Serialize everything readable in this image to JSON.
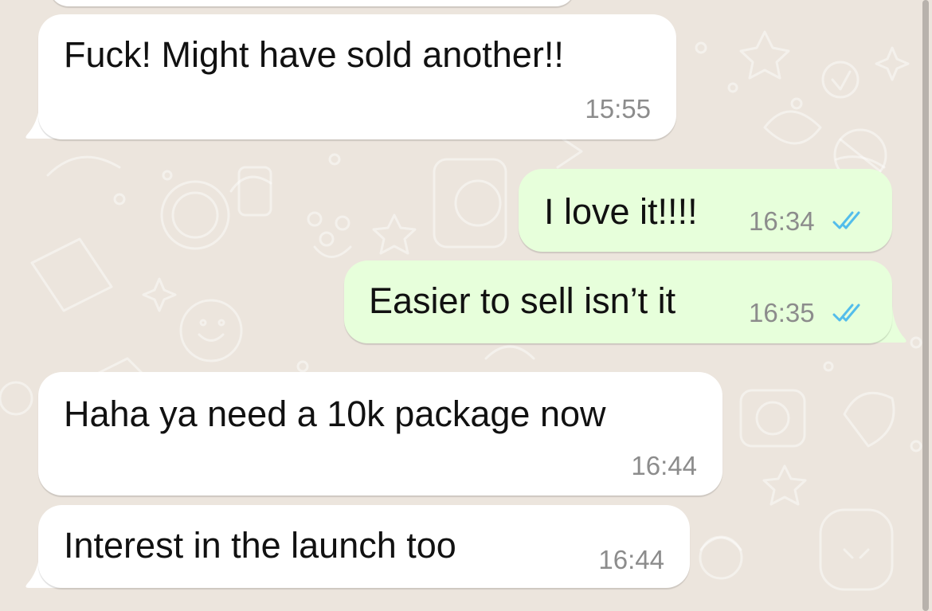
{
  "chat": {
    "background_color": "#ECE5DD",
    "incoming_bubble_color": "#FFFFFF",
    "outgoing_bubble_color": "#E7FFDB",
    "read_tick_color": "#53BDEB",
    "messages": [
      {
        "direction": "incoming",
        "text": "Fuck! Might have sold another!!",
        "time": "15:55"
      },
      {
        "direction": "outgoing",
        "text": "I love it!!!!",
        "time": "16:34",
        "status": "read",
        "status_icon": "double-check-icon"
      },
      {
        "direction": "outgoing",
        "text": "Easier to sell isn’t it",
        "time": "16:35",
        "status": "read",
        "status_icon": "double-check-icon"
      },
      {
        "direction": "incoming",
        "text": "Haha ya need a 10k package now",
        "time": "16:44"
      },
      {
        "direction": "incoming",
        "text": "Interest in the launch too",
        "time": "16:44"
      }
    ]
  }
}
